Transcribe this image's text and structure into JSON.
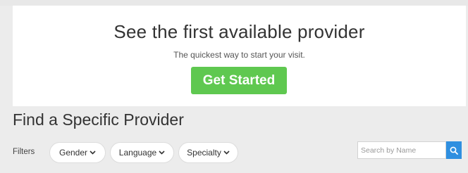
{
  "hero": {
    "title": "See the first available provider",
    "subtitle": "The quickest way to start your visit.",
    "cta_label": "Get Started"
  },
  "section": {
    "title": "Find a Specific Provider"
  },
  "filters": {
    "label": "Filters",
    "items": [
      {
        "label": "Gender",
        "icon": "chevron-down-icon"
      },
      {
        "label": "Language",
        "icon": "chevron-down-icon"
      },
      {
        "label": "Specialty",
        "icon": "chevron-down-icon"
      }
    ]
  },
  "search": {
    "placeholder": "Search by Name",
    "value": "",
    "icon": "search-icon"
  },
  "colors": {
    "cta": "#5fc850",
    "search_button": "#2f8fe0",
    "page_background": "#ececec"
  }
}
